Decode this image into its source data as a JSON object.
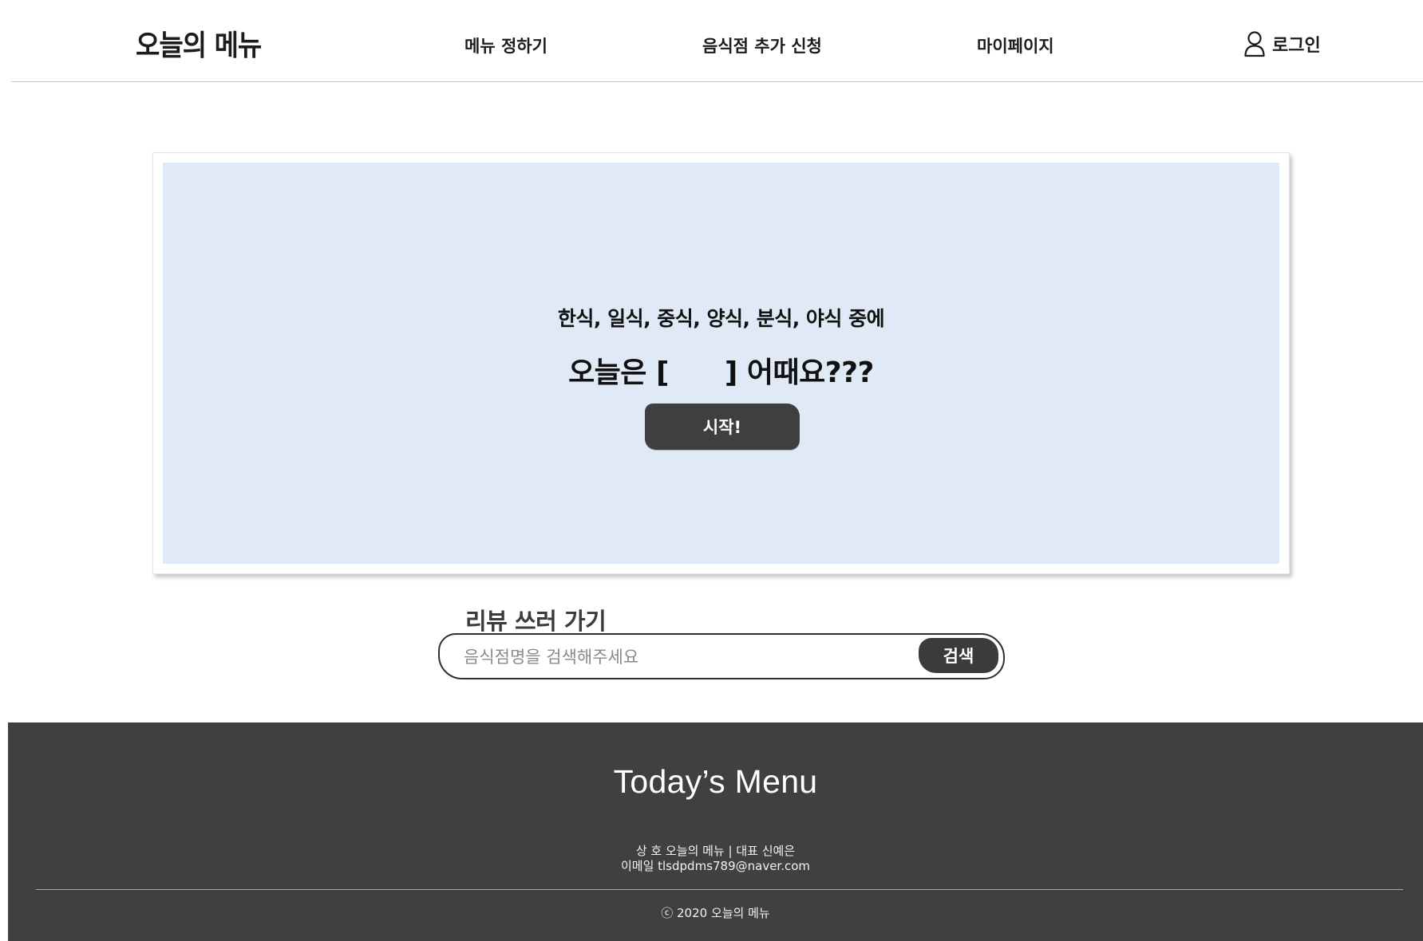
{
  "header": {
    "logo": "오늘의 메뉴",
    "nav": [
      {
        "label": "메뉴 정하기"
      },
      {
        "label": "음식점 추가 신청"
      },
      {
        "label": "마이페이지"
      }
    ],
    "login_label": "로그인",
    "login_icon": "user-icon"
  },
  "hero": {
    "subtitle": "한식, 일식, 중식, 양식, 분식, 야식 중에",
    "title_prefix": "오늘은 [",
    "title_slot": "",
    "title_suffix": "] 어때요???",
    "start_label": "시작!",
    "background_color": "#dfeaf6"
  },
  "review": {
    "title": "리뷰 쓰러 가기",
    "search_placeholder": "음식점명을 검색해주세요",
    "search_value": "",
    "search_button": "검색"
  },
  "footer": {
    "brand": "Today’s Menu",
    "info_line1": "상 호 오늘의 메뉴 | 대표 신예은",
    "info_line2": "이메일 tlsdpdms789@naver.com",
    "copyright": "ⓒ 2020 오늘의 메뉴",
    "background_color": "#404040"
  }
}
